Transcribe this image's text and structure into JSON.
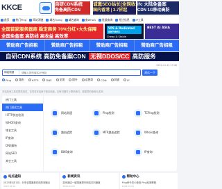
{
  "header": {
    "logo": "KKCE",
    "ads": [
      {
        "line1": "自研CDN系统",
        "line2": "免备高防CDN"
      },
      {
        "line1": "诚邀SEO站长[全网收录]",
        "line2": "国内香港 | 3.7折起"
      },
      {
        "line1": "ifc 大陆免备案",
        "line2": "CDN 1G移动高防"
      }
    ]
  },
  "menu": [
    {
      "label": "首页",
      "icon": "home-icon"
    },
    {
      "label": "热门Ping",
      "icon": "ping-icon"
    },
    {
      "label": "网站测速",
      "icon": "speed-icon"
    },
    {
      "label": "域名Tping",
      "icon": "tping-icon"
    },
    {
      "label": "域名查询",
      "icon": "search-icon"
    },
    {
      "label": "查Whois",
      "icon": "whois-icon"
    },
    {
      "label": "批量查询",
      "icon": "batch-icon"
    },
    {
      "label": "抢注信息",
      "icon": "info-icon"
    },
    {
      "label": "IP工具",
      "icon": "ip-icon"
    }
  ],
  "banners": {
    "red_line1": "全国首家服务器商 稳定商务 70%分红+大头保障",
    "red_line2": "全国免备案 高防线 高收益 高效率",
    "vps_badge": "VPS & Dedicated servers",
    "vps_sub": "Cheap & Stable",
    "ai_text": "BEST AI ASIA"
  },
  "sponsors": [
    "赞助商广告招租",
    "赞助商广告招租",
    "赞助商广告招租",
    "赞助商广告招租"
  ],
  "big_banner": {
    "text": "自研CDN系统 高防免备案CDN",
    "highlight": "无视DDOS/CC",
    "tail": "高防服务"
  },
  "search": {
    "date": "2022-11-12 17:48",
    "type_label": "网站测速",
    "placeholder": "请输入您的域名/IP地址",
    "button": "测试一下",
    "options": [
      {
        "label": "Ping",
        "checked": true
      },
      {
        "label": "路由",
        "checked": false
      },
      {
        "label": "HTTP",
        "checked": false
      },
      {
        "label": "DNS",
        "checked": false
      },
      {
        "label": "全国",
        "checked": false
      },
      {
        "label": "国外",
        "checked": false
      },
      {
        "label": "运营商",
        "checked": false
      },
      {
        "label": "CDN",
        "checked": false
      },
      {
        "label": "网速",
        "checked": false
      },
      {
        "label": "IP",
        "checked": false
      }
    ]
  },
  "notice": "本站查询工具仅提供测试，请勿将本站用于违法用途。如有问题可以联系我们，感谢您的使用与支持！",
  "tools": {
    "side": [
      {
        "label": "热门工具",
        "active": false
      },
      {
        "label": "热门测试工具",
        "active": true
      },
      {
        "label": "HTTP状态检测",
        "active": false
      },
      {
        "label": "WHOIS查询",
        "active": false
      },
      {
        "label": "域名工具",
        "active": false
      },
      {
        "label": "IP查询",
        "active": false
      },
      {
        "label": "DNS解析",
        "active": false
      },
      {
        "label": "网站SEO",
        "active": false
      },
      {
        "label": "其它工具",
        "active": false
      }
    ],
    "cards": [
      {
        "label": "网站测速"
      },
      {
        "label": "Ping检测"
      },
      {
        "label": "TCPing检测"
      },
      {
        "label": "路由追踪"
      },
      {
        "label": "MTR路由追踪"
      },
      {
        "label": "Whois查询"
      },
      {
        "label": "DNS查询"
      },
      {
        "label": "IP查询"
      }
    ]
  },
  "bottom": [
    {
      "title": "站点通知",
      "line": "2023年4月1日：分享全国最新在线的测速点",
      "date": "2023-04-01"
    },
    {
      "title": "新闻资讯",
      "line": "如何通过一键测速提升网站访问速度",
      "date": "2023-03-15"
    },
    {
      "title": "帮助中心",
      "line": "Ping命令怎么使用 Ping检测教程",
      "date": "2023-03-01"
    }
  ]
}
